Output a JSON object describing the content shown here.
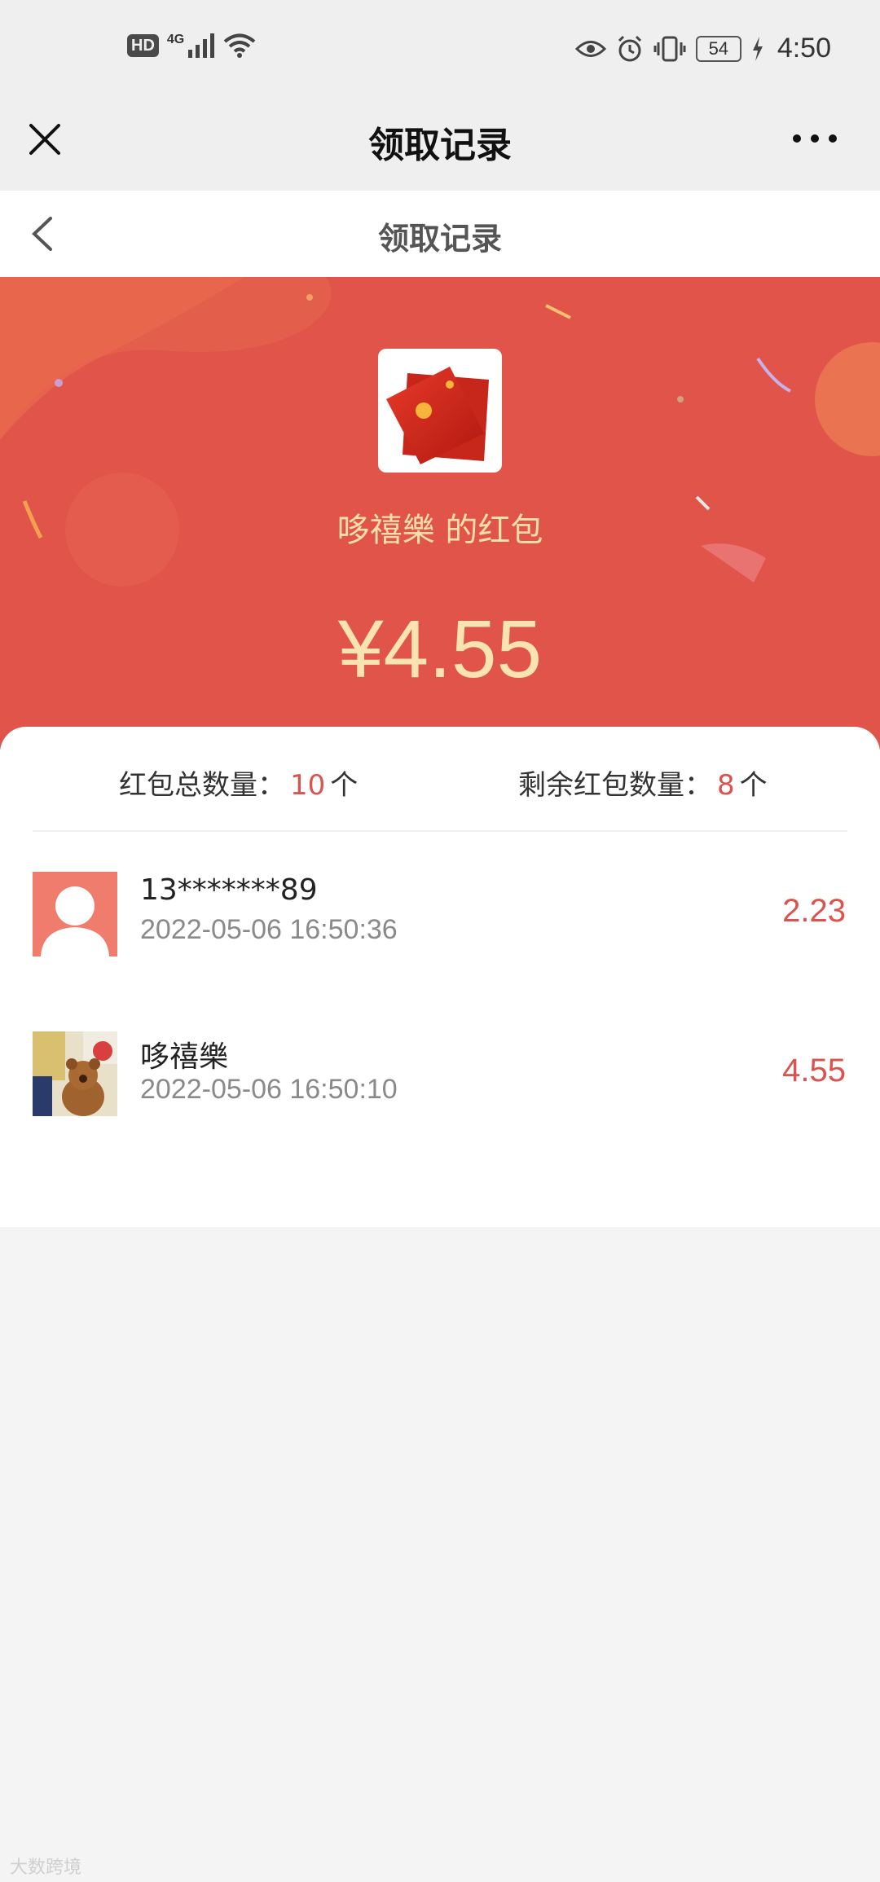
{
  "status_bar": {
    "hd_label": "HD",
    "network_label": "4G",
    "battery": "54",
    "time": "4:50"
  },
  "nav": {
    "title": "领取记录",
    "close_icon": "close-icon",
    "more_icon": "more-icon"
  },
  "sub_header": {
    "title": "领取记录",
    "back_icon": "chevron-left-icon"
  },
  "hero": {
    "sender_text": "哆禧樂 的红包",
    "amount": "¥4.55",
    "bg_color": "#e0544a",
    "text_color": "#f8dfa9"
  },
  "stats": {
    "total_label": "红包总数量：",
    "total_value": "10",
    "total_unit": "个",
    "remaining_label": "剩余红包数量：",
    "remaining_value": "8",
    "remaining_unit": "个"
  },
  "records": [
    {
      "name": "13*******89",
      "time": "2022-05-06 16:50:36",
      "amount": "2.23",
      "avatar": "default-avatar-icon"
    },
    {
      "name": "哆禧樂",
      "time": "2022-05-06 16:50:10",
      "amount": "4.55",
      "avatar": "teddy-bear-photo"
    }
  ],
  "watermark": "大数跨境",
  "colors": {
    "accent_red": "#d9534f",
    "page_bg": "#f4f4f4"
  }
}
